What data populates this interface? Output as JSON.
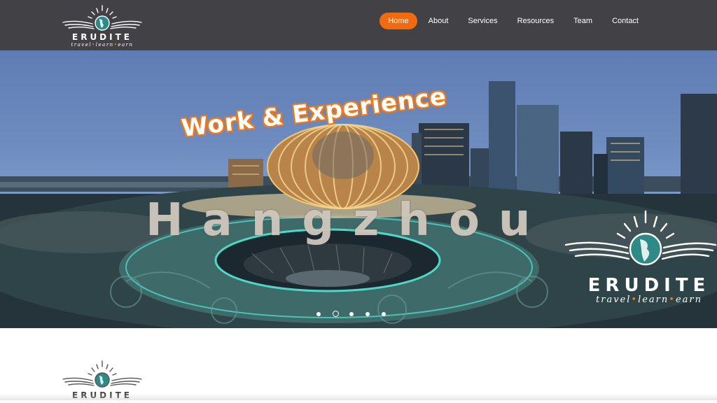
{
  "header": {
    "logo": {
      "brand": "ERUDITE",
      "tagline": [
        "travel",
        "learn",
        "earn"
      ],
      "tagline_separator": "•"
    },
    "nav": [
      {
        "label": "Home",
        "active": true
      },
      {
        "label": "About",
        "active": false
      },
      {
        "label": "Services",
        "active": false
      },
      {
        "label": "Resources",
        "active": false
      },
      {
        "label": "Team",
        "active": false
      },
      {
        "label": "Contact",
        "active": false
      }
    ]
  },
  "hero": {
    "title": "Work & Experience",
    "city": "Hangzhou",
    "logo": {
      "brand": "ERUDITE",
      "tagline": [
        "travel",
        "learn",
        "earn"
      ],
      "tagline_separator": "•"
    },
    "slider": {
      "slide_count": 5,
      "active_index": 1
    }
  },
  "below": {
    "logo": {
      "brand": "ERUDITE"
    }
  },
  "colors": {
    "header_bg": "#414146",
    "accent": "#f06a0f",
    "nav_text": "#ffffff"
  },
  "icons": {
    "logo": "sun-rays-globe-wings-icon"
  }
}
